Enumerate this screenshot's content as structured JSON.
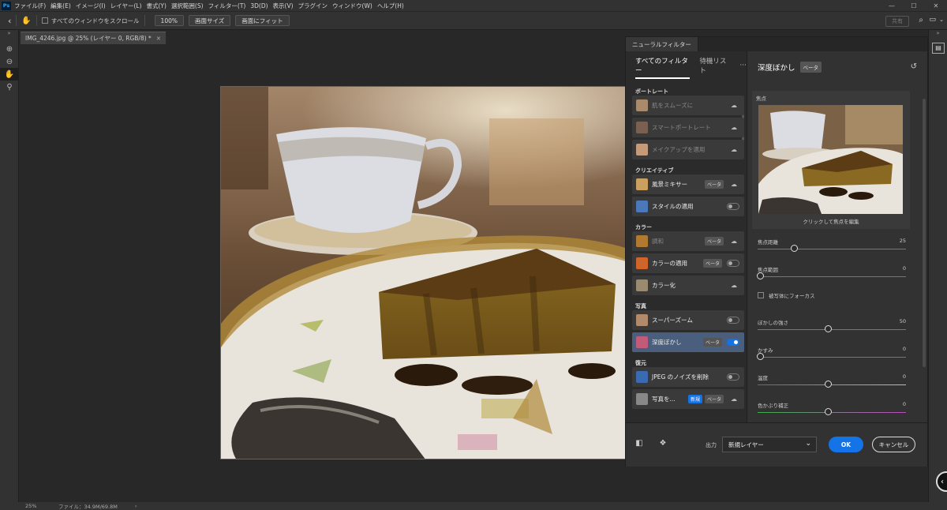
{
  "menubar": {
    "logo": "Ps",
    "items": [
      "ファイル(F)",
      "編集(E)",
      "イメージ(I)",
      "レイヤー(L)",
      "書式(Y)",
      "選択範囲(S)",
      "フィルター(T)",
      "3D(D)",
      "表示(V)",
      "プラグイン",
      "ウィンドウ(W)",
      "ヘルプ(H)"
    ]
  },
  "options": {
    "scroll_all": "すべてのウィンドウをスクロール",
    "zoom": "100%",
    "fit_screen": "画面サイズ",
    "fill_screen": "画面にフィット",
    "share": "共有"
  },
  "document": {
    "tab_title": "IMG_4246.jpg @ 25% (レイヤー 0, RGB/8) *",
    "tab_close": "×"
  },
  "status": {
    "zoom": "25%",
    "file_info": "ファイル：34.9M/69.8M",
    "arrow": "›"
  },
  "neural": {
    "panel_title": "ニューラルフィルター",
    "tab_all": "すべてのフィルター",
    "tab_waitlist": "待機リスト",
    "more": "···",
    "categories": {
      "portrait": "ポートレート",
      "creative": "クリエイティブ",
      "color": "カラー",
      "photo": "写真",
      "restore": "復元"
    },
    "filters": {
      "skin": "肌をスムーズに",
      "smart_portrait": "スマートポートレート",
      "makeup": "メイクアップを適用",
      "landscape": "風景ミキサー",
      "style": "スタイルの適用",
      "harmonize": "調和",
      "color_transfer": "カラーの適用",
      "colorize": "カラー化",
      "super_zoom": "スーパーズーム",
      "depth_blur": "深度ぼかし",
      "jpeg": "JPEG のノイズを削除",
      "photo_restore": "写真を..."
    },
    "badges": {
      "beta": "ベータ",
      "new": "新規"
    },
    "right": {
      "title": "深度ぼかし",
      "beta": "ベータ",
      "focus_label": "焦点",
      "preview_caption": "クリックして焦点を編集",
      "focal_distance": {
        "label": "焦点距離",
        "value": 25
      },
      "focal_range": {
        "label": "焦点範囲",
        "value": 0
      },
      "focus_subject": "被写体にフォーカス",
      "blur_strength": {
        "label": "ぼかしの強さ",
        "value": 50
      },
      "haze": {
        "label": "かすみ",
        "value": 0
      },
      "temperature": {
        "label": "温度",
        "value": 0
      },
      "tint": {
        "label": "色かぶり補正",
        "value": 0
      }
    },
    "footer": {
      "output_label": "出力",
      "output_value": "新規レイヤー",
      "ok": "OK",
      "cancel": "キャンセル"
    }
  },
  "colors": {
    "accent": "#1473e6",
    "selected_row": "#4a5f7d",
    "canvas_border": "#1e6fd9"
  }
}
